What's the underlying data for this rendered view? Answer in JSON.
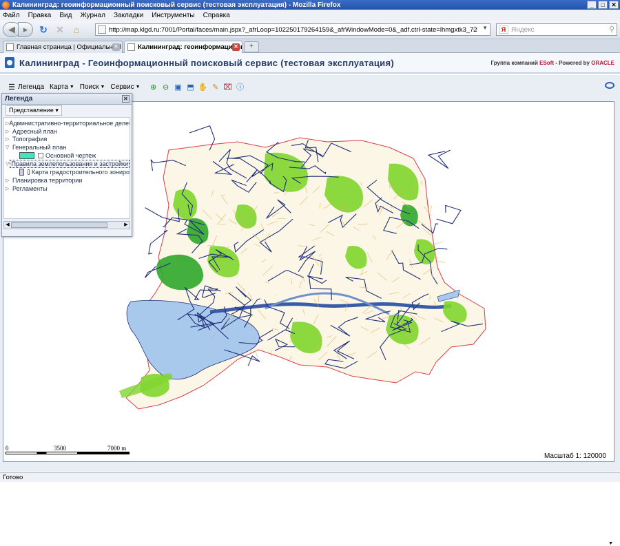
{
  "window": {
    "title": "Калининград: геоинформационный поисковый сервис (тестовая эксплуатация) - Mozilla Firefox",
    "controls": [
      "_",
      "□",
      "✕"
    ]
  },
  "menu": [
    "Файл",
    "Правка",
    "Вид",
    "Журнал",
    "Закладки",
    "Инструменты",
    "Справка"
  ],
  "nav": {
    "url": "http://map.klgd.ru:7001/Portal/faces/main.jspx?_afrLoop=102250179264159&_afrWindowMode=0&_adf.ctrl-state=lhmgxtk3_72",
    "search_placeholder": "Яндекс"
  },
  "tabs": [
    {
      "label": "Главная страница | Официальный са...",
      "active": false
    },
    {
      "label": "Калининград: геоинформационный ...",
      "active": true
    }
  ],
  "app": {
    "title": "Калининград - Геоинформационный поисковый сервис (тестовая эксплуатация)",
    "brand_prefix": "Группа компаний ",
    "brand_esoft": "ESoft",
    "brand_middle": " - Powered by ",
    "brand_oracle": "ORACLE"
  },
  "toolbar": {
    "legend": "Легенда",
    "map": "Карта",
    "search": "Поиск",
    "service": "Сервис"
  },
  "legend": {
    "title": "Легенда",
    "view_button": "Представление",
    "items": [
      {
        "label": "Административно-территориальное деление",
        "expanded": false
      },
      {
        "label": "Адресный план",
        "expanded": false
      },
      {
        "label": "Топография",
        "expanded": false
      },
      {
        "label": "Генеральный план",
        "expanded": true
      },
      {
        "label": "Основной чертеж",
        "sub": true,
        "swatch": "#3ee6c0"
      },
      {
        "label": "Правила землепользования и застройки",
        "expanded": true,
        "selected": true
      },
      {
        "label": "Карта градостроительного зониро",
        "sub": true,
        "swatch": "#c9c9f2"
      },
      {
        "label": "Планировка территории",
        "expanded": false
      },
      {
        "label": "Регламенты",
        "expanded": false
      }
    ]
  },
  "scale": {
    "labels": [
      "0",
      "3500",
      "7000 m"
    ],
    "text": "Масштаб 1: 120000"
  },
  "status": "Готово",
  "colors": {
    "water": "#a8c8ec",
    "green": "#7fd62e",
    "darkgreen": "#2fa82a",
    "roads": "#1f2f78",
    "sand": "#f0e0a8",
    "boundary": "#d83b4a"
  }
}
